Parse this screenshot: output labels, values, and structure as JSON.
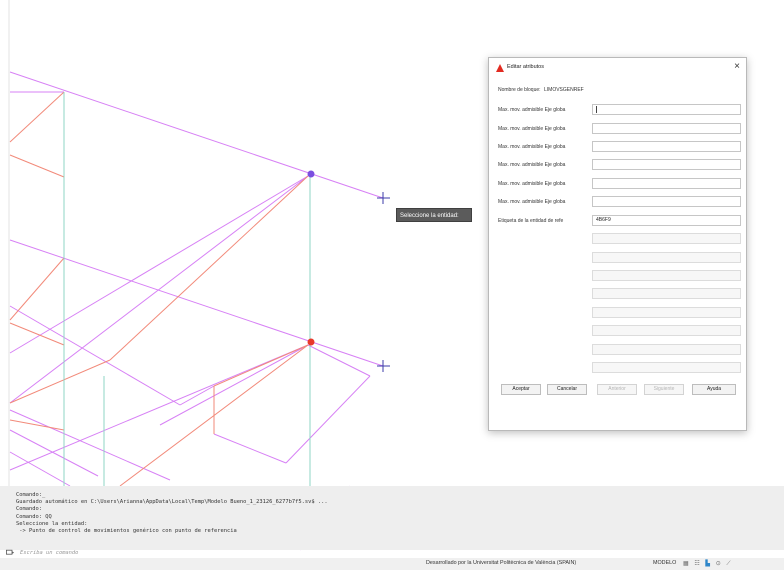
{
  "tooltip": {
    "text": "Seleccione la entidad:"
  },
  "dialog": {
    "title": "Editar atributos",
    "block_name_label": "Nombre de bloque:",
    "block_name_value": "LIMOVSGENREF",
    "attributes": [
      {
        "label": "Max. mov. admisible Eje globa",
        "value": ""
      },
      {
        "label": "Max. mov. admisible Eje globa",
        "value": ""
      },
      {
        "label": "Max. mov. admisible Eje globa",
        "value": ""
      },
      {
        "label": "Max. mov. admisible Eje globa",
        "value": ""
      },
      {
        "label": "Max. mov. admisible Eje globa",
        "value": ""
      },
      {
        "label": "Max. mov. admisible Eje globa",
        "value": ""
      },
      {
        "label": "Etiqueta de la entidad de refe",
        "value": "4B6F9"
      }
    ],
    "buttons": {
      "ok": "Aceptar",
      "cancel": "Cancelar",
      "previous": "Anterior",
      "next": "Siguiente",
      "help": "Ayuda"
    }
  },
  "command": {
    "history": [
      "Comando:_",
      "Guardado automático en C:\\Users\\Arianna\\AppData\\Local\\Temp\\Modelo Bueno_1_23126_6277b7f5.sv$ ...",
      "Comando:",
      "Comando: QQ",
      "Seleccione la entidad:",
      " -> Punto de control de movimientos genérico con punto de referencia"
    ],
    "placeholder": "Escriba un comando"
  },
  "status": {
    "credit": "Desarrollado por la Universitat Politècnica de València (SPAIN)",
    "model": "MODELO",
    "icons": [
      "grid-icon",
      "snap-icon",
      "ortho-icon",
      "polar-icon",
      "isodraft-icon"
    ]
  },
  "colors": {
    "magenta_lines": "#d781f5",
    "red_lines": "#f28a7a",
    "cyan_lines": "#8fd4c4",
    "selected_red_node": "#e8382a",
    "selected_purple_node": "#7b4ee0",
    "crosshair": "#3b3ba8"
  }
}
